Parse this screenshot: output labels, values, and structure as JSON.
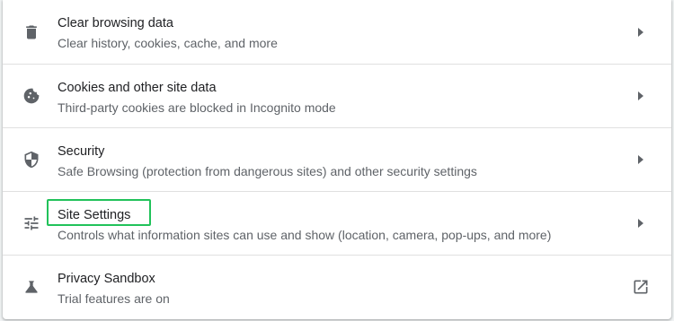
{
  "rows": [
    {
      "title": "Clear browsing data",
      "subtitle": "Clear history, cookies, cache, and more",
      "icon": "trash-icon",
      "action_icon": "chevron-right-icon"
    },
    {
      "title": "Cookies and other site data",
      "subtitle": "Third-party cookies are blocked in Incognito mode",
      "icon": "cookie-icon",
      "action_icon": "chevron-right-icon"
    },
    {
      "title": "Security",
      "subtitle": "Safe Browsing (protection from dangerous sites) and other security settings",
      "icon": "shield-icon",
      "action_icon": "chevron-right-icon"
    },
    {
      "title": "Site Settings",
      "subtitle": "Controls what information sites can use and show (location, camera, pop-ups, and more)",
      "icon": "tune-icon",
      "action_icon": "chevron-right-icon",
      "highlighted": true
    },
    {
      "title": "Privacy Sandbox",
      "subtitle": "Trial features are on",
      "icon": "flask-icon",
      "action_icon": "open-in-new-icon"
    }
  ],
  "colors": {
    "highlight": "#21c25a",
    "icon": "#5f6368",
    "title_text": "#202124",
    "subtitle_text": "#5f6368",
    "divider": "#e0e0e0"
  }
}
